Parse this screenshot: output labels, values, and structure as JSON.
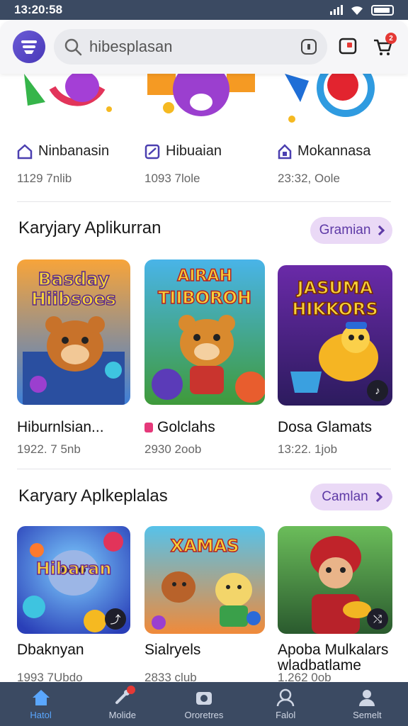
{
  "status": {
    "time": "13:20:58"
  },
  "header": {
    "search_value": "hibesplasan"
  },
  "top_row": [
    {
      "label": "Ninbanasin",
      "meta": "1129 7nlib"
    },
    {
      "label": "Hibuaian",
      "meta": "1093 7lole"
    },
    {
      "label": "Mokannasa",
      "meta": "23:32, Oole"
    }
  ],
  "section1": {
    "title": "Karyjary Aplikurran",
    "more_label": "Gramian",
    "cards": [
      {
        "art_text": [
          "Basday",
          "Hiibsoes"
        ],
        "title": "Hiburnlsian...",
        "meta": "1922. 7 5nb"
      },
      {
        "art_text": [
          "AIRAH",
          "TIIBOROH"
        ],
        "title": "Golclahs",
        "meta": "2930 2oob"
      },
      {
        "art_text": [
          "JASUMA",
          "HIKKORS"
        ],
        "title": "Dosa Glamats",
        "meta": "13:22. 1job"
      }
    ]
  },
  "section2": {
    "title": "Karyary Aplkeplalas",
    "more_label": "Camlan",
    "cards": [
      {
        "art_text": [
          "Hibaran"
        ],
        "title": "Dbaknyan",
        "meta": "1993 7Ubdo"
      },
      {
        "art_text": [
          "XAMAS"
        ],
        "title": "Sialryels",
        "meta": "2833 club"
      },
      {
        "art_text": [],
        "title": "Apoba Mulkalars\nwladbatlame",
        "meta": "1.262 0ob"
      }
    ]
  },
  "nav": [
    {
      "label": "Hatol",
      "icon": "home-icon"
    },
    {
      "label": "Molide",
      "icon": "game-icon"
    },
    {
      "label": "Ororetres",
      "icon": "camera-icon"
    },
    {
      "label": "Falol",
      "icon": "person-icon"
    },
    {
      "label": "Semelt",
      "icon": "profile-icon"
    }
  ]
}
